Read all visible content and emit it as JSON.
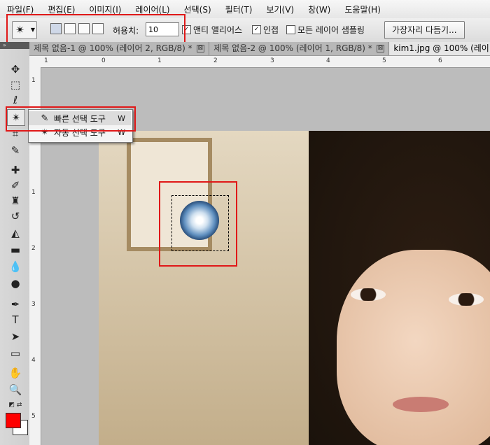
{
  "menu": [
    "파일(F)",
    "편집(E)",
    "이미지(I)",
    "레이어(L)",
    "선택(S)",
    "필터(T)",
    "보기(V)",
    "창(W)",
    "도움말(H)"
  ],
  "options": {
    "tool_preset_icon": "magic-wand-icon",
    "tolerance_label": "허용치:",
    "tolerance_value": "10",
    "anti_alias": {
      "label": "앤티 앨리어스",
      "checked": true
    },
    "contiguous": {
      "label": "인접",
      "checked": true
    },
    "sample_all": {
      "label": "모든 레이어 샘플링",
      "checked": false
    },
    "refine_edge": "가장자리 다듬기..."
  },
  "tabs": [
    {
      "title": "제목 없음-1 @ 100% (레이어 2, RGB/8) *",
      "close": "⊠"
    },
    {
      "title": "제목 없음-2 @ 100% (레이어 1, RGB/8) *",
      "close": "⊠"
    },
    {
      "title": "kim1.jpg @ 100% (레이",
      "close": ""
    }
  ],
  "ruler": {
    "h": [
      "1",
      "0",
      "1",
      "2",
      "3",
      "4",
      "5",
      "6"
    ],
    "v": [
      "1",
      "1",
      "2",
      "3",
      "4",
      "5"
    ]
  },
  "flyout": [
    {
      "icon": "quick-selection-icon",
      "name": "빠른 선택 도구",
      "key": "W"
    },
    {
      "icon": "magic-wand-icon",
      "name": "자동 선택 도구",
      "key": "W"
    }
  ],
  "colors": {
    "foreground": "#ff0000",
    "background": "#ffffff",
    "highlight": "#e01818"
  }
}
